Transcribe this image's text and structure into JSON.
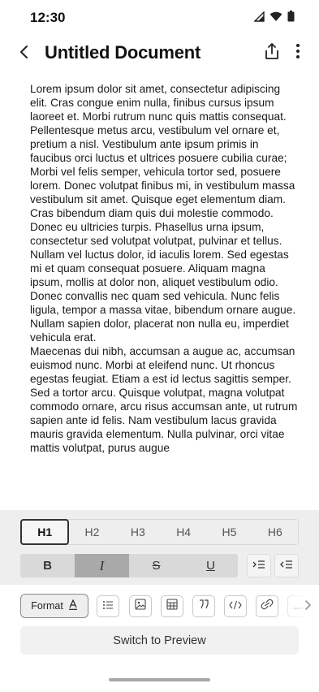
{
  "status_bar": {
    "time": "12:30",
    "icons": [
      "signal-icon",
      "wifi-icon",
      "battery-icon"
    ]
  },
  "app_bar": {
    "title": "Untitled Document",
    "back_icon": "chevron-left-icon",
    "share_icon": "share-icon",
    "more_icon": "more-vertical-icon"
  },
  "document": {
    "paragraphs": [
      "Lorem ipsum dolor sit amet, consectetur adipiscing elit. Cras congue enim nulla, finibus cursus ipsum laoreet et. Morbi rutrum nunc quis mattis consequat. Pellentesque metus arcu, vestibulum vel ornare et, pretium a nisl. Vestibulum ante ipsum primis in faucibus orci luctus et ultrices posuere cubilia curae; Morbi vel felis semper, vehicula tortor sed, posuere lorem. Donec volutpat finibus mi, in vestibulum massa vestibulum sit amet. Quisque eget elementum diam. Cras bibendum diam quis dui molestie commodo.",
      "Donec eu ultricies turpis. Phasellus urna ipsum, consectetur sed volutpat volutpat, pulvinar et tellus. Nullam vel luctus dolor, id iaculis lorem. Sed egestas mi et quam consequat posuere. Aliquam magna ipsum, mollis at dolor non, aliquet vestibulum odio. Donec convallis nec quam sed vehicula. Nunc felis ligula, tempor a massa vitae, bibendum ornare augue. Nullam sapien dolor, placerat non nulla eu, imperdiet vehicula erat.",
      "Maecenas dui nibh, accumsan a augue ac, accumsan euismod nunc. Morbi at eleifend nunc. Ut rhoncus egestas feugiat. Etiam a est id lectus sagittis semper. Sed a tortor arcu. Quisque volutpat, magna volutpat commodo ornare, arcu risus accumsan ante, ut rutrum sapien ante id felis. Nam vestibulum lacus gravida mauris gravida elementum. Nulla pulvinar, orci vitae mattis volutpat, purus augue"
    ]
  },
  "toolbar": {
    "headings": [
      {
        "label": "H1",
        "active": true
      },
      {
        "label": "H2",
        "active": false
      },
      {
        "label": "H3",
        "active": false
      },
      {
        "label": "H4",
        "active": false
      },
      {
        "label": "H5",
        "active": false
      },
      {
        "label": "H6",
        "active": false
      }
    ],
    "styles": [
      {
        "name": "bold",
        "glyph": "B",
        "active": false
      },
      {
        "name": "italic",
        "glyph": "I",
        "active": true
      },
      {
        "name": "strikethrough",
        "glyph": "S",
        "active": false
      },
      {
        "name": "underline",
        "glyph": "U",
        "active": false
      }
    ],
    "indent_icons": [
      "indent-icon",
      "outdent-icon"
    ],
    "format_chip": {
      "label": "Format",
      "icon": "text-color-icon"
    },
    "insert_icons": [
      "bullet-list-icon",
      "image-icon",
      "table-icon",
      "quote-icon",
      "code-icon",
      "link-icon",
      "divider-icon"
    ],
    "scroll_icon": "chevron-right-icon",
    "preview_button": "Switch to Preview"
  },
  "colors": {
    "panel_bg": "#eeeeee",
    "active_style_bg": "#a9a9a9",
    "style_row_bg": "#d9d9d9",
    "text": "#111111"
  }
}
